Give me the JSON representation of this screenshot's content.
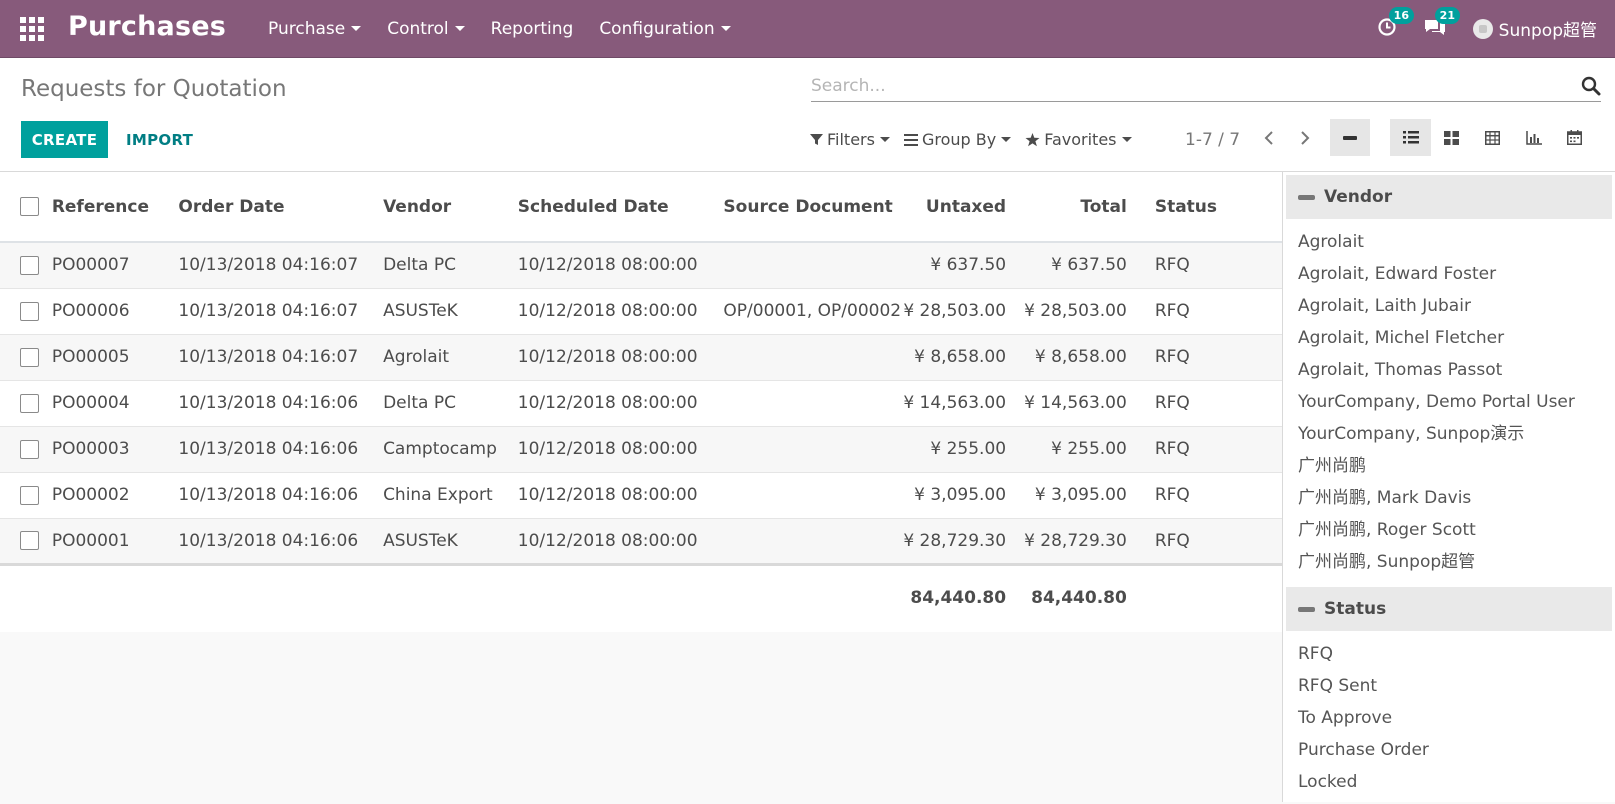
{
  "app": {
    "title": "Purchases",
    "menu": [
      {
        "label": "Purchase",
        "dropdown": true
      },
      {
        "label": "Control",
        "dropdown": true
      },
      {
        "label": "Reporting",
        "dropdown": false
      },
      {
        "label": "Configuration",
        "dropdown": true
      }
    ],
    "activity_count": "16",
    "message_count": "21",
    "user_name": "Sunpop超管"
  },
  "control_panel": {
    "page_title": "Requests for Quotation",
    "search_placeholder": "Search...",
    "create_label": "CREATE",
    "import_label": "IMPORT",
    "filters_label": "Filters",
    "group_by_label": "Group By",
    "favorites_label": "Favorites",
    "pager_value": "1-7 / 7",
    "active_view": "list"
  },
  "table": {
    "columns": [
      "Reference",
      "Order Date",
      "Vendor",
      "Scheduled Date",
      "Source Document",
      "Untaxed",
      "Total",
      "Status"
    ],
    "rows": [
      {
        "reference": "PO00007",
        "order_date": "10/13/2018 04:16:07",
        "vendor": "Delta PC",
        "scheduled_date": "10/12/2018 08:00:00",
        "source": "",
        "untaxed": "¥ 637.50",
        "total": "¥ 637.50",
        "status": "RFQ"
      },
      {
        "reference": "PO00006",
        "order_date": "10/13/2018 04:16:07",
        "vendor": "ASUSTeK",
        "scheduled_date": "10/12/2018 08:00:00",
        "source": "OP/00001, OP/00002",
        "untaxed": "¥ 28,503.00",
        "total": "¥ 28,503.00",
        "status": "RFQ"
      },
      {
        "reference": "PO00005",
        "order_date": "10/13/2018 04:16:07",
        "vendor": "Agrolait",
        "scheduled_date": "10/12/2018 08:00:00",
        "source": "",
        "untaxed": "¥ 8,658.00",
        "total": "¥ 8,658.00",
        "status": "RFQ"
      },
      {
        "reference": "PO00004",
        "order_date": "10/13/2018 04:16:06",
        "vendor": "Delta PC",
        "scheduled_date": "10/12/2018 08:00:00",
        "source": "",
        "untaxed": "¥ 14,563.00",
        "total": "¥ 14,563.00",
        "status": "RFQ"
      },
      {
        "reference": "PO00003",
        "order_date": "10/13/2018 04:16:06",
        "vendor": "Camptocamp",
        "scheduled_date": "10/12/2018 08:00:00",
        "source": "",
        "untaxed": "¥ 255.00",
        "total": "¥ 255.00",
        "status": "RFQ"
      },
      {
        "reference": "PO00002",
        "order_date": "10/13/2018 04:16:06",
        "vendor": "China Export",
        "scheduled_date": "10/12/2018 08:00:00",
        "source": "",
        "untaxed": "¥ 3,095.00",
        "total": "¥ 3,095.00",
        "status": "RFQ"
      },
      {
        "reference": "PO00001",
        "order_date": "10/13/2018 04:16:06",
        "vendor": "ASUSTeK",
        "scheduled_date": "10/12/2018 08:00:00",
        "source": "",
        "untaxed": "¥ 28,729.30",
        "total": "¥ 28,729.30",
        "status": "RFQ"
      }
    ],
    "totals": {
      "untaxed": "84,440.80",
      "total": "84,440.80"
    }
  },
  "sidebar": {
    "vendor_title": "Vendor",
    "vendors": [
      "Agrolait",
      "Agrolait, Edward Foster",
      "Agrolait, Laith Jubair",
      "Agrolait, Michel Fletcher",
      "Agrolait, Thomas Passot",
      "YourCompany, Demo Portal User",
      "YourCompany, Sunpop演示",
      "广州尚鹏",
      "广州尚鹏, Mark Davis",
      "广州尚鹏, Roger Scott",
      "广州尚鹏, Sunpop超管"
    ],
    "status_title": "Status",
    "statuses": [
      "RFQ",
      "RFQ Sent",
      "To Approve",
      "Purchase Order",
      "Locked"
    ]
  },
  "colors": {
    "brand": "#875a7b",
    "accent": "#00a09d",
    "link": "#017e84"
  }
}
